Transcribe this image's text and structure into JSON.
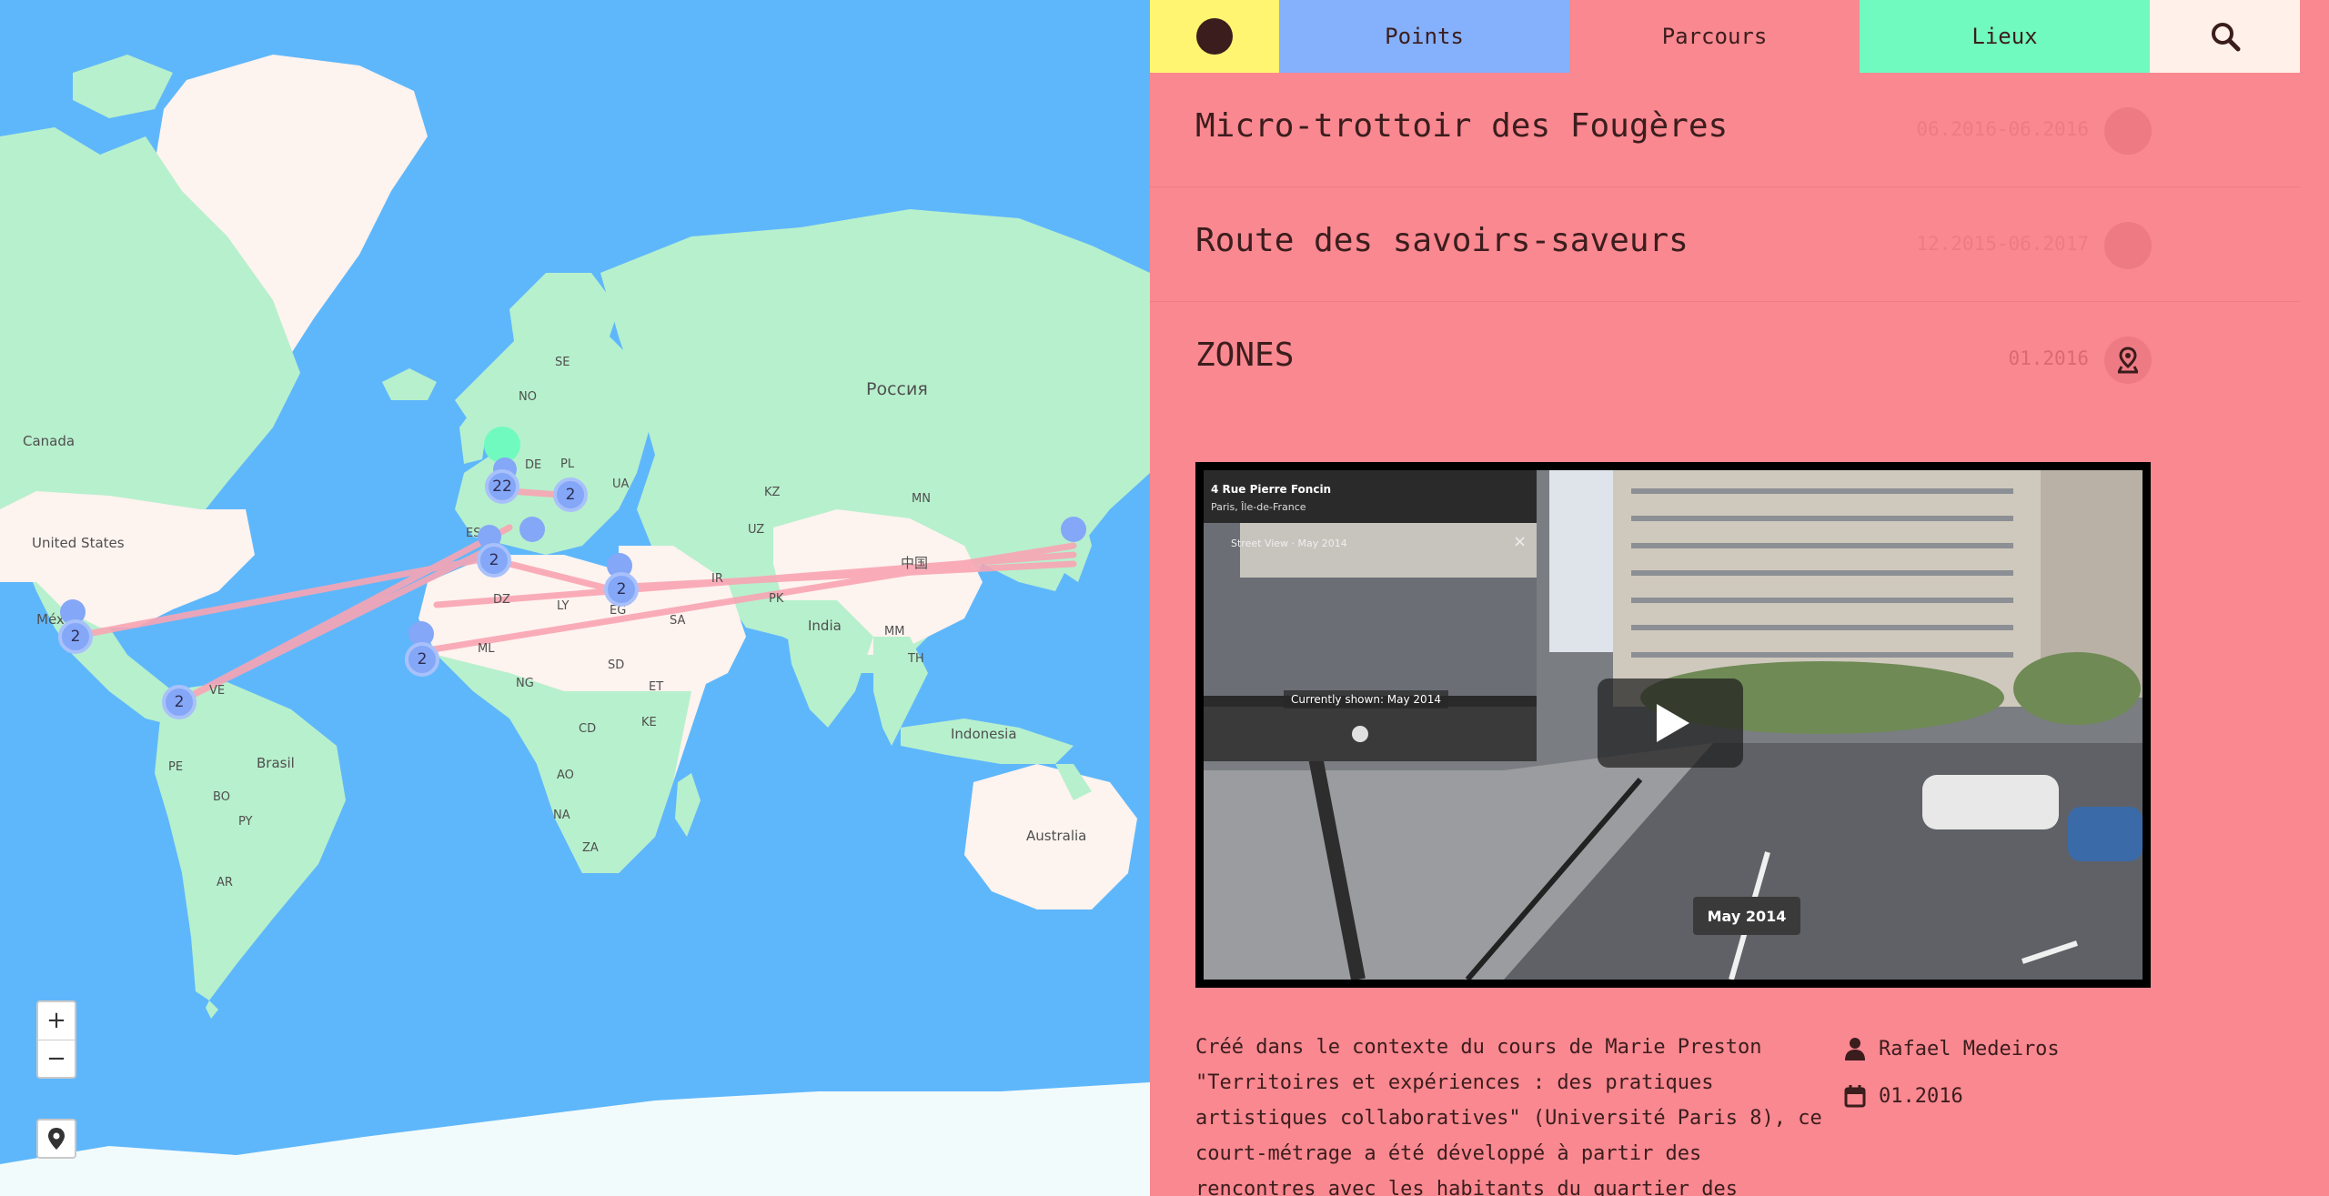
{
  "map": {
    "labels": {
      "canada": "Canada",
      "united_states": "United States",
      "mexico": "Méx",
      "russia": "Россия",
      "se": "SE",
      "no": "NO",
      "de": "DE",
      "pl": "PL",
      "ua": "UA",
      "es": "ES",
      "ly": "LY",
      "dz": "DZ",
      "eg": "EG",
      "sa": "SA",
      "ir": "IR",
      "kz": "KZ",
      "uz": "UZ",
      "mn": "MN",
      "china": "中国",
      "india": "India",
      "pk": "PK",
      "ml": "ML",
      "ng": "NG",
      "et": "ET",
      "sd": "SD",
      "cd": "CD",
      "ke": "KE",
      "ao": "AO",
      "na": "NA",
      "za": "ZA",
      "mm": "MM",
      "th": "TH",
      "indonesia": "Indonesia",
      "australia": "Australia",
      "brasil": "Brasil",
      "pe": "PE",
      "bo": "BO",
      "py": "PY",
      "ar": "AR",
      "ve": "VE",
      "ir2": "IR"
    },
    "clusters": {
      "c_uk": "22",
      "c_fr": "2",
      "c_es": "2",
      "c_east": "2",
      "c_eg": "2",
      "c_wa": "2",
      "c_co": "2",
      "c_mx": "2"
    },
    "zoom_in": "+",
    "zoom_out": "−"
  },
  "nav": {
    "points": "Points",
    "parcours": "Parcours",
    "lieux": "Lieux"
  },
  "list": [
    {
      "title": "Micro-trottoir des Fougères",
      "date": "06.2016-06.2016"
    },
    {
      "title": "Route des savoirs-saveurs",
      "date": "12.2015-06.2017"
    },
    {
      "title": "ZONES",
      "date": "01.2016"
    }
  ],
  "video": {
    "sv_address": "4 Rue Pierre Foncin",
    "sv_city": "Paris, Île-de-France",
    "sv_panel_title": "Street View · May 2014",
    "sv_currently": "Currently shown: May 2014",
    "sv_date_badge": "May 2014"
  },
  "detail": {
    "description": "Créé dans le contexte du cours de Marie Preston \"Territoires et expériences : des pratiques artistiques collaboratives\" (Université Paris 8), ce court-métrage a été développé à partir des rencontres avec les habitants du quartier des Fougères, situé à",
    "author": "Rafael Medeiros",
    "date": "01.2016"
  },
  "colors": {
    "map_water": "#5fb7fb",
    "land_green": "#b7f0cd",
    "land_cream": "#fdf3ef",
    "accent_yellow": "#fff571",
    "accent_blue": "#85b1fc",
    "accent_pink": "#f98890",
    "accent_green": "#71fabf",
    "search_bg": "#fff1ea",
    "text_dark": "#3b1d1d"
  },
  "icons": {
    "logo": "circle-logo-icon",
    "search": "search-icon",
    "person": "person-icon",
    "calendar": "calendar-icon",
    "pin": "map-pin-icon",
    "play": "play-icon"
  }
}
